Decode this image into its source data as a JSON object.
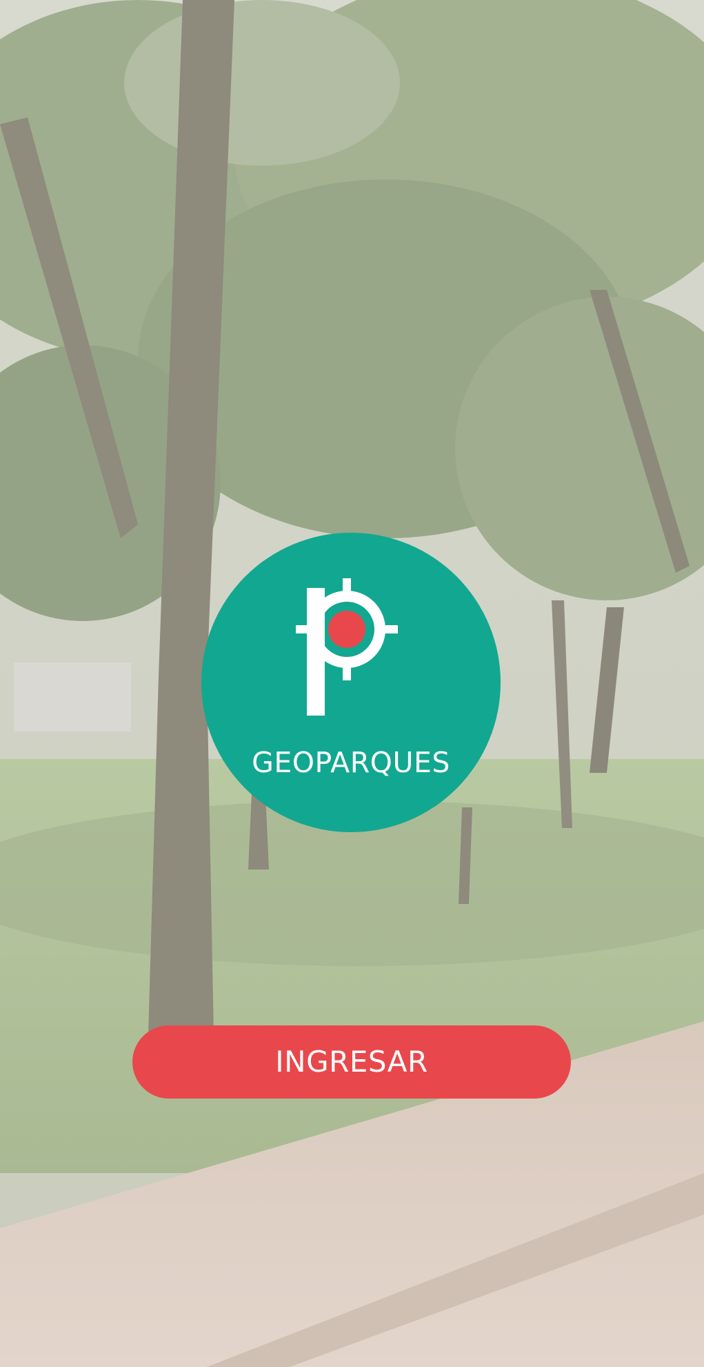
{
  "app": {
    "brand_name": "GEOPARQUES"
  },
  "background": {
    "description_icon": "park-photo"
  },
  "logo": {
    "icon": "map-pin-p-icon",
    "badge_color": "#12a790",
    "dot_color": "#e8484c"
  },
  "actions": {
    "enter_label": "INGRESAR",
    "enter_color": "#e8484c"
  }
}
